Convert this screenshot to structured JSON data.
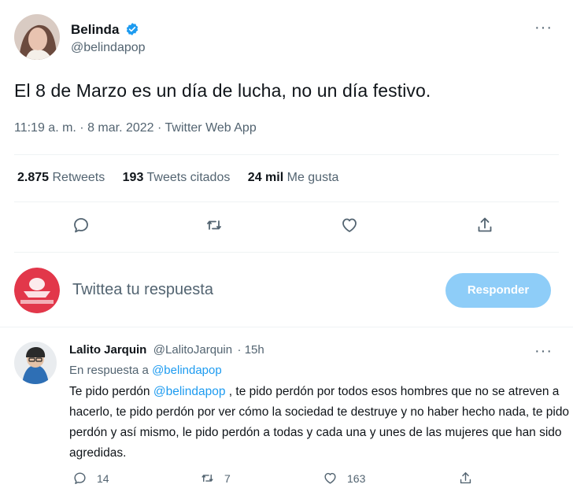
{
  "tweet": {
    "author_name": "Belinda",
    "author_handle": "@belindapop",
    "text": "El 8 de Marzo es un día de lucha, no un día festivo.",
    "timestamp": "11:19 a. m. · 8 mar. 2022 · Twitter Web App",
    "more_label": "···",
    "stats": {
      "retweets_count": "2.875",
      "retweets_label": "Retweets",
      "quotes_count": "193",
      "quotes_label": "Tweets citados",
      "likes_count": "24 mil",
      "likes_label": "Me gusta"
    },
    "actions": [
      "reply-icon",
      "retweet-icon",
      "like-icon",
      "share-icon"
    ]
  },
  "compose": {
    "placeholder": "Twittea tu respuesta",
    "button_label": "Responder",
    "button_color": "#8ecdf8"
  },
  "reply": {
    "author_name": "Lalito Jarquin",
    "author_handle": "@LalitoJarquin",
    "time": "· 15h",
    "more_label": "···",
    "in_reply_label": "En respuesta a",
    "in_reply_handle": "@belindapop",
    "body_pre": "Te pido perdón",
    "body_mention": "@belindapop",
    "body_post": ", te pido perdón por todos esos hombres que no se atreven a hacerlo, te pido perdón por ver cómo la sociedad te destruye y no haber hecho nada, te pido perdón y así mismo, le pido perdón a todas y cada una y unes de las mujeres que han sido agredidas.",
    "reply_count": "14",
    "retweet_count": "7",
    "like_count": "163"
  },
  "colors": {
    "link": "#1d9bf0",
    "verified": "#1d9bf0",
    "secondary_text": "#536471"
  }
}
